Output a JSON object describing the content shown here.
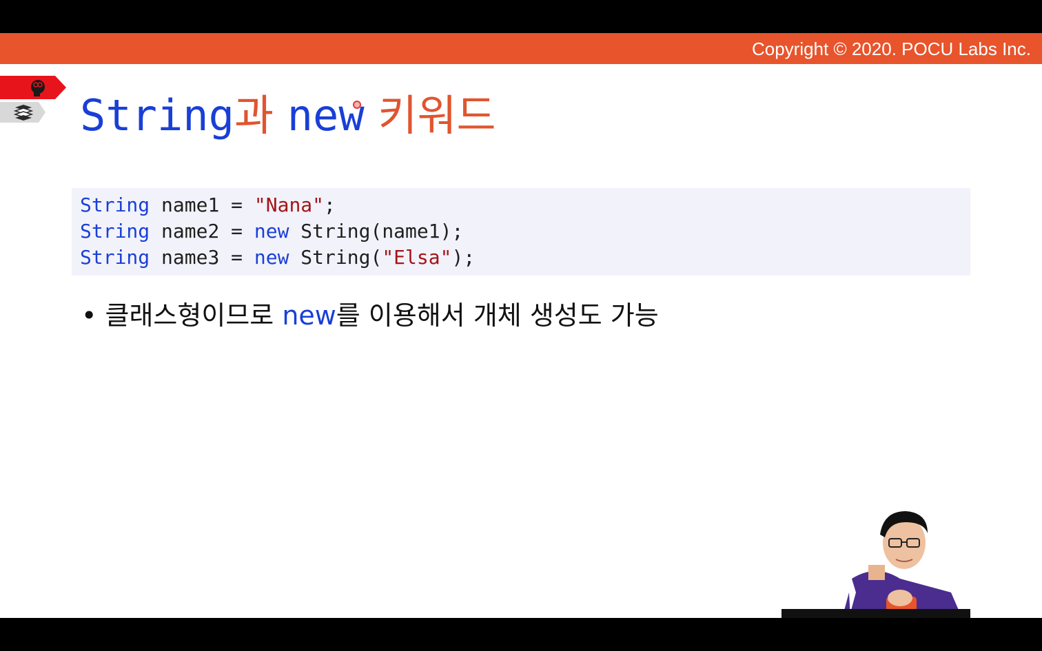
{
  "header": {
    "copyright": "Copyright © 2020. POCU Labs Inc."
  },
  "title": {
    "part1": "String",
    "part2": "과 ",
    "part3": "new",
    "part4": " 키워드"
  },
  "code": {
    "lines": [
      {
        "type": "String",
        "rest": " name1 = ",
        "new": "",
        "call": "",
        "str": "\"Nana\"",
        "end": ";"
      },
      {
        "type": "String",
        "rest": " name2 = ",
        "new": "new",
        "call": " String(name1);",
        "str": "",
        "end": ""
      },
      {
        "type": "String",
        "rest": " name3 = ",
        "new": "new",
        "call": " String(",
        "str": "\"Elsa\"",
        "end": ");"
      }
    ]
  },
  "bullet": {
    "marker": "•",
    "before": "클래스형이므로 ",
    "keyword": "new",
    "after": "를 이용해서 개체 생성도 가능"
  },
  "icons": {
    "tab_red": "brain-head-icon",
    "tab_gray": "stacked-books-icon"
  },
  "colors": {
    "accent_orange": "#e8542c",
    "keyword_blue": "#1a3fd6",
    "string_red": "#a31515",
    "title_orange": "#e0552f",
    "tab_red": "#e8141c",
    "code_bg": "#f2f2fb"
  }
}
